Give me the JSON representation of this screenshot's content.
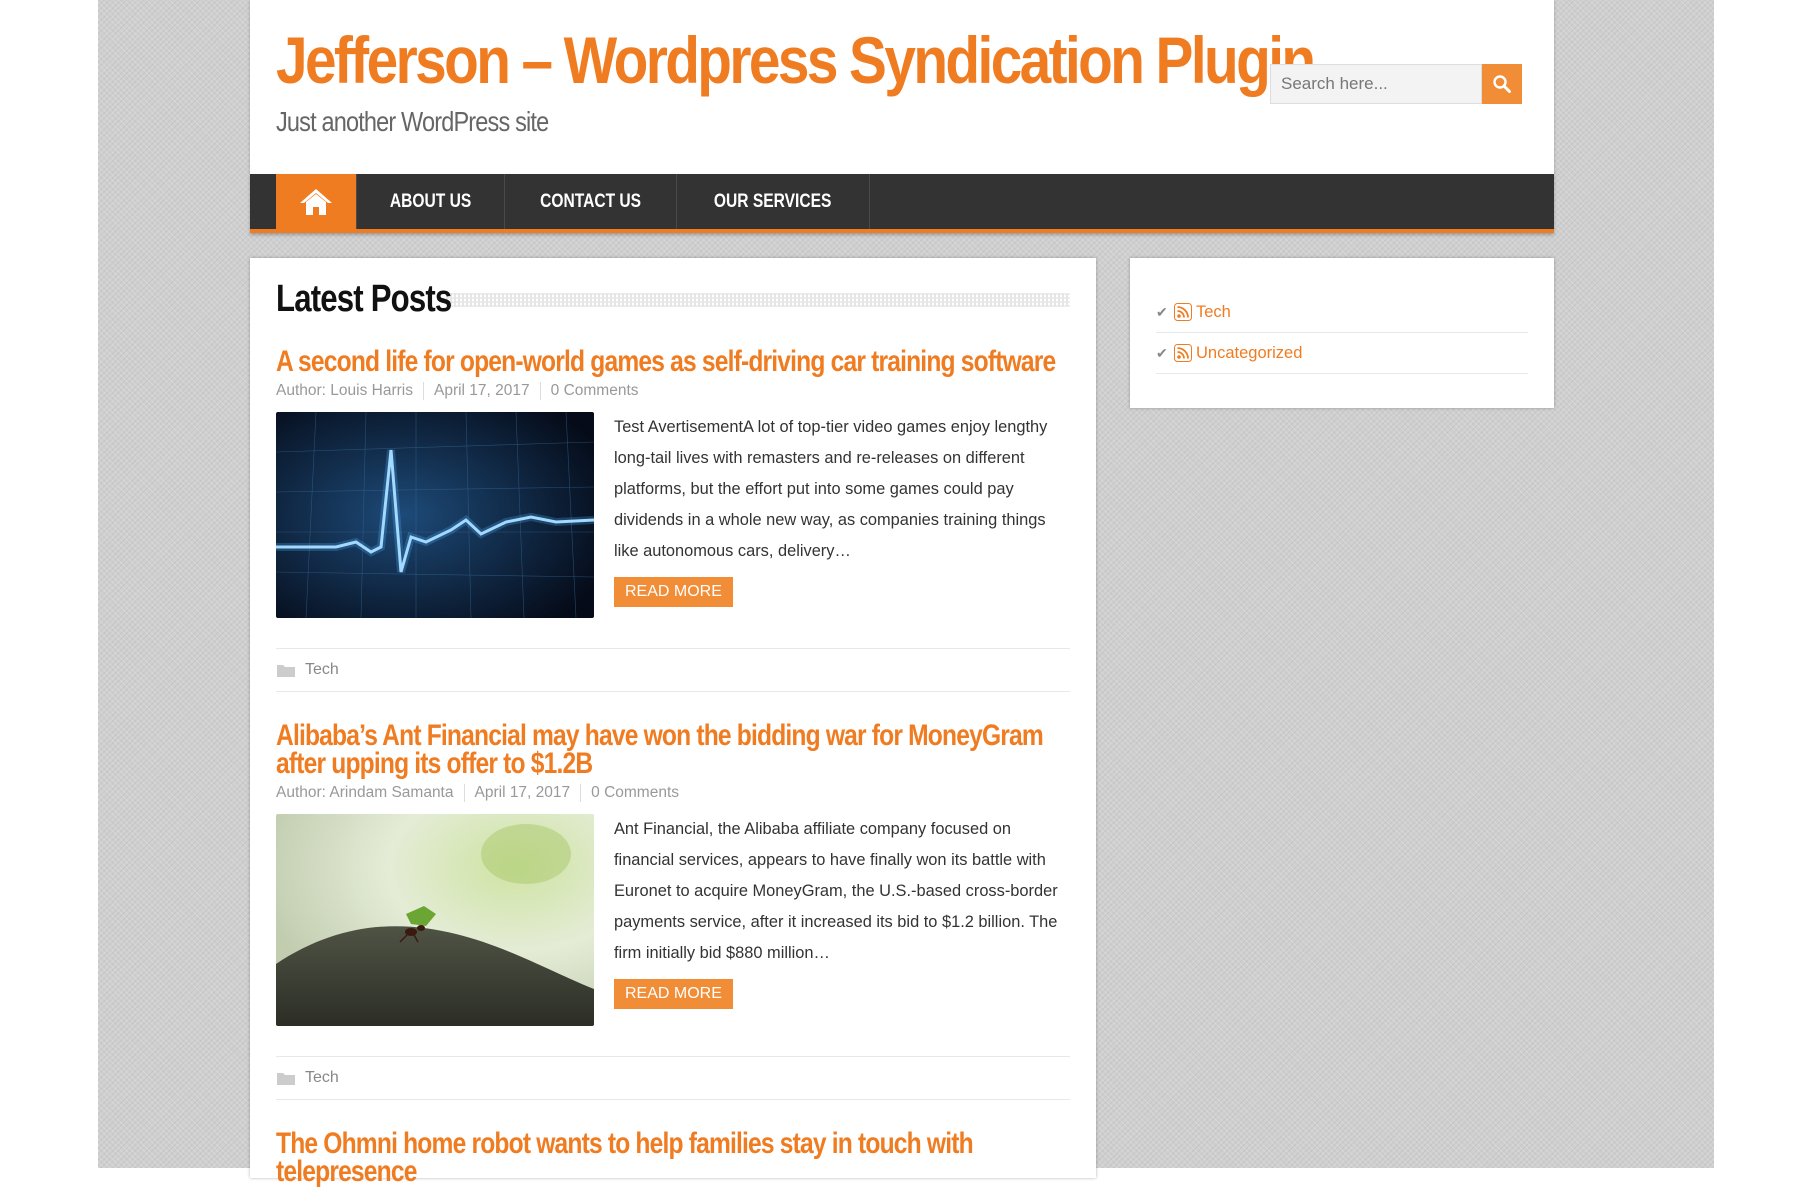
{
  "site": {
    "title": "Jefferson – Wordpress Syndication Plugin",
    "tagline": "Just another WordPress site"
  },
  "search": {
    "placeholder": "Search here..."
  },
  "nav": {
    "items": [
      {
        "label": "ABOUT US"
      },
      {
        "label": "CONTACT US"
      },
      {
        "label": "OUR SERVICES"
      }
    ]
  },
  "main": {
    "section_title": "Latest Posts",
    "posts": [
      {
        "title": "A second life for open-world games as self-driving car training software",
        "author": "Author: Louis Harris",
        "date": "April 17, 2017",
        "comments": "0 Comments",
        "excerpt": "Test AvertisementA lot of top-tier video games enjoy lengthy long-tail lives with remasters and re-releases on different platforms, but the effort put into some games could pay dividends in a whole new way, as companies training things like autonomous cars, delivery…",
        "read_more": "READ MORE",
        "category": "Tech"
      },
      {
        "title": "Alibaba’s Ant Financial may have won the bidding war for MoneyGram after upping its offer to $1.2B",
        "author": "Author: Arindam Samanta",
        "date": "April 17, 2017",
        "comments": "0 Comments",
        "excerpt": "Ant Financial, the Alibaba affiliate company focused on financial services, appears to have finally won its battle with Euronet to acquire MoneyGram, the U.S.-based cross-border payments service, after it increased its bid to $1.2 billion. The firm initially bid $880 million…",
        "read_more": "READ MORE",
        "category": "Tech"
      },
      {
        "title": "The Ohmni home robot wants to help families stay in touch with telepresence"
      }
    ]
  },
  "sidebar": {
    "categories": [
      {
        "label": "Tech"
      },
      {
        "label": "Uncategorized"
      }
    ]
  },
  "colors": {
    "accent": "#f07c22",
    "nav_bg": "#333333"
  }
}
